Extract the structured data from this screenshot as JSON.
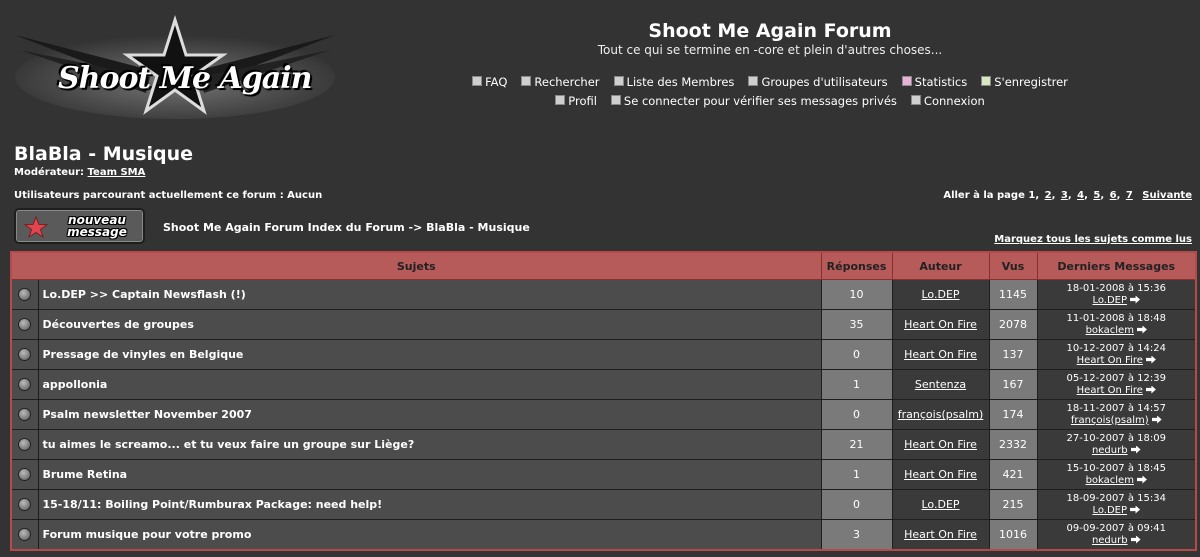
{
  "logo": {
    "text": "Shoot Me Again"
  },
  "site": {
    "title": "Shoot Me Again Forum",
    "description": "Tout ce qui se termine en -core et plein d'autres choses..."
  },
  "nav": {
    "row1": [
      "FAQ",
      "Rechercher",
      "Liste des Membres",
      "Groupes d'utilisateurs",
      "Statistics",
      "S'enregistrer"
    ],
    "row2": [
      "Profil",
      "Se connecter pour vérifier ses messages privés",
      "Connexion"
    ]
  },
  "forum": {
    "title": "BlaBla - Musique",
    "moderator_label": "Modérateur:",
    "moderator_name": "Team SMA",
    "users_online": "Utilisateurs parcourant actuellement ce forum : Aucun"
  },
  "pagination": {
    "label": "Aller à la page",
    "current": "1",
    "pages": [
      "2",
      "3",
      "4",
      "5",
      "6",
      "7"
    ],
    "next": "Suivante"
  },
  "new_topic_button": {
    "line1": "nouveau",
    "line2": "message"
  },
  "breadcrumb": {
    "index": "Shoot Me Again Forum Index du Forum",
    "separator": "->",
    "current": "BlaBla - Musique"
  },
  "mark_all": "Marquez tous les sujets comme lus",
  "table": {
    "headers": {
      "topics": "Sujets",
      "replies": "Réponses",
      "author": "Auteur",
      "views": "Vus",
      "last": "Derniers Messages"
    },
    "rows": [
      {
        "title": "Lo.DEP >> Captain Newsflash (!)",
        "replies": "10",
        "author": "Lo.DEP",
        "views": "1145",
        "last_date": "18-01-2008 à 15:36",
        "last_author": "Lo.DEP"
      },
      {
        "title": "Découvertes de groupes",
        "replies": "35",
        "author": "Heart On Fire",
        "views": "2078",
        "last_date": "11-01-2008 à 18:48",
        "last_author": "bokaclem"
      },
      {
        "title": "Pressage de vinyles en Belgique",
        "replies": "0",
        "author": "Heart On Fire",
        "views": "137",
        "last_date": "10-12-2007 à 14:24",
        "last_author": "Heart On Fire"
      },
      {
        "title": "appollonia",
        "replies": "1",
        "author": "Sentenza",
        "views": "167",
        "last_date": "05-12-2007 à 12:39",
        "last_author": "Heart On Fire"
      },
      {
        "title": "Psalm newsletter November 2007",
        "replies": "0",
        "author": "françois(psalm)",
        "views": "174",
        "last_date": "18-11-2007 à 14:57",
        "last_author": "françois(psalm)"
      },
      {
        "title": "tu aimes le screamo... et tu veux faire un groupe sur Liège?",
        "replies": "21",
        "author": "Heart On Fire",
        "views": "2332",
        "last_date": "27-10-2007 à 18:09",
        "last_author": "nedurb"
      },
      {
        "title": "Brume Retina",
        "replies": "1",
        "author": "Heart On Fire",
        "views": "421",
        "last_date": "15-10-2007 à 18:45",
        "last_author": "bokaclem"
      },
      {
        "title": "15-18/11: Boiling Point/Rumburax Package: need help!",
        "replies": "0",
        "author": "Lo.DEP",
        "views": "215",
        "last_date": "18-09-2007 à 15:34",
        "last_author": "Lo.DEP"
      },
      {
        "title": "Forum musique pour votre promo",
        "replies": "3",
        "author": "Heart On Fire",
        "views": "1016",
        "last_date": "09-09-2007 à 09:41",
        "last_author": "nedurb"
      }
    ]
  }
}
